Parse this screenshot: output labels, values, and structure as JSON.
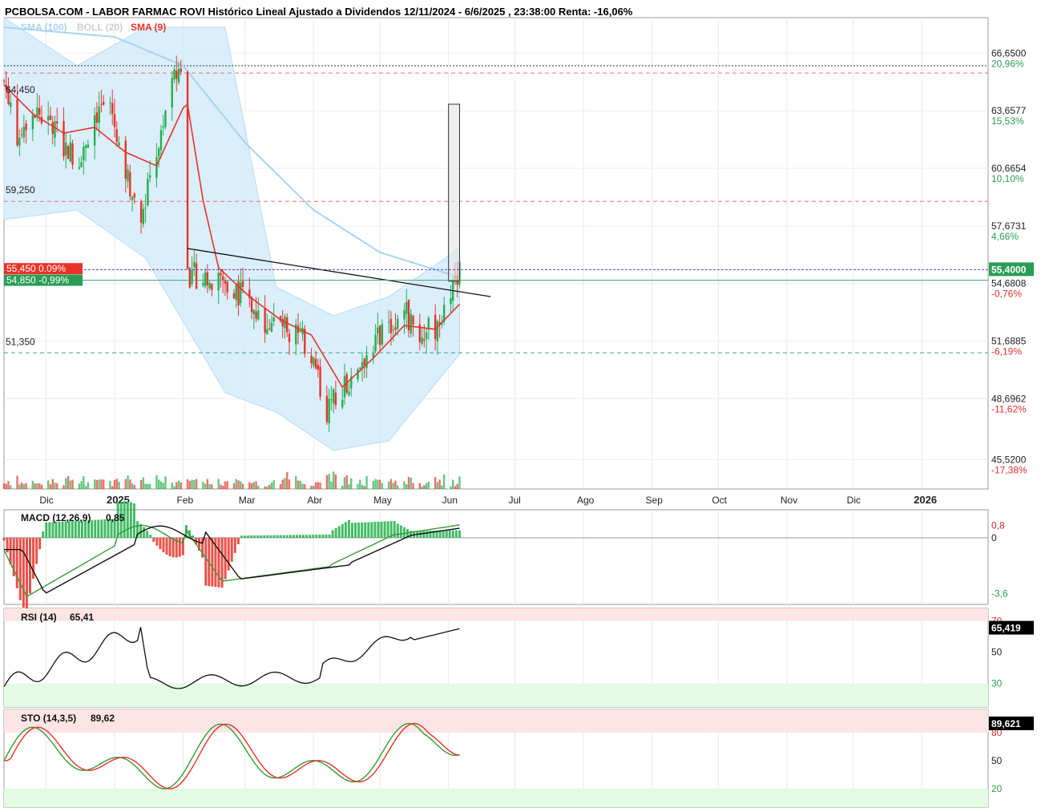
{
  "title": "PCBOLSA.COM - LABOR FARMAC ROVI Histórico Lineal Ajustado a Dividendos 12/11/2024 - 6/6/2025 , 23:38:00 Renta: -16,06%",
  "legend": {
    "sma100": "SMA (100)",
    "boll": "BOLL (20)",
    "sma9": "SMA (9)"
  },
  "colors": {
    "up": "#22b04b",
    "down": "#e8332a",
    "sma9": "#e8332a",
    "sma100": "#a8d4f0",
    "boll_fill": "#cfe8fb",
    "accent_green": "#2a9d55",
    "accent_red": "#e03030"
  },
  "chart_data": [
    {
      "type": "candlestick",
      "name": "price",
      "yrange": [
        44.0,
        68.5
      ],
      "y_axis_levels": [
        {
          "value": 66.65,
          "label": "66,6500",
          "pct": "20,96%",
          "tone": "up"
        },
        {
          "value": 63.6577,
          "label": "63,6577",
          "pct": "15,53%",
          "tone": "up"
        },
        {
          "value": 60.6654,
          "label": "60,6654",
          "pct": "10,10%",
          "tone": "up"
        },
        {
          "value": 57.6731,
          "label": "57,6731",
          "pct": "4,66%",
          "tone": "up"
        },
        {
          "value": 54.6808,
          "label": "54,6808",
          "pct": "-0,76%",
          "tone": "down"
        },
        {
          "value": 51.6885,
          "label": "51,6885",
          "pct": "-6,19%",
          "tone": "down"
        },
        {
          "value": 48.6962,
          "label": "48,6962",
          "pct": "-11,62%",
          "tone": "down"
        },
        {
          "value": 45.52,
          "label": "45,5200",
          "pct": "-17,38%",
          "tone": "down"
        }
      ],
      "left_levels": [
        {
          "value": 64.45,
          "label": "64,450"
        },
        {
          "value": 59.25,
          "label": "59,250"
        },
        {
          "value": 51.35,
          "label": "51,350"
        }
      ],
      "hlines": [
        {
          "value": 65.62,
          "style": "dashed",
          "color": "#f07070"
        },
        {
          "value": 58.95,
          "style": "dashed",
          "color": "#f07070"
        },
        {
          "value": 51.08,
          "style": "dashed",
          "color": "#3aa673"
        },
        {
          "value": 66.0,
          "style": "dotted",
          "color": "#333"
        }
      ],
      "last_price": {
        "value": 55.4,
        "label": "55,4000"
      },
      "markers": [
        {
          "value": 55.45,
          "text": "55,450  0.09%",
          "color": "#e8332a"
        },
        {
          "value": 54.85,
          "text": "54,850  -0,99%",
          "color": "#2a9d55"
        }
      ],
      "x_labels": [
        "Dic",
        "2025",
        "Feb",
        "Mar",
        "Abr",
        "May",
        "Jun",
        "Jul",
        "Ago",
        "Sep",
        "Oct",
        "Nov",
        "Dic",
        "2026"
      ],
      "xrange": [
        "2024-11-12",
        "2026-01-31"
      ],
      "ohlc_anchor_dates": [
        "2024-11-12",
        "2024-12-01",
        "2025-01-01",
        "2025-02-01",
        "2025-03-01",
        "2025-04-01",
        "2025-05-01",
        "2025-06-01",
        "2025-06-06"
      ],
      "close_path": [
        {
          "date": "2024-11-12",
          "value": 65.2
        },
        {
          "date": "2024-11-18",
          "value": 62.5
        },
        {
          "date": "2024-11-25",
          "value": 63.8
        },
        {
          "date": "2024-12-02",
          "value": 63.0
        },
        {
          "date": "2024-12-09",
          "value": 61.8
        },
        {
          "date": "2024-12-16",
          "value": 61.2
        },
        {
          "date": "2024-12-23",
          "value": 63.5
        },
        {
          "date": "2024-12-30",
          "value": 64.0
        },
        {
          "date": "2025-01-06",
          "value": 60.5
        },
        {
          "date": "2025-01-13",
          "value": 58.0
        },
        {
          "date": "2025-01-20",
          "value": 61.5
        },
        {
          "date": "2025-01-27",
          "value": 65.0
        },
        {
          "date": "2025-02-01",
          "value": 66.3
        },
        {
          "date": "2025-02-03",
          "value": 55.2
        },
        {
          "date": "2025-02-10",
          "value": 55.0
        },
        {
          "date": "2025-02-17",
          "value": 54.8
        },
        {
          "date": "2025-02-24",
          "value": 54.5
        },
        {
          "date": "2025-03-03",
          "value": 53.5
        },
        {
          "date": "2025-03-10",
          "value": 52.8
        },
        {
          "date": "2025-03-17",
          "value": 52.5
        },
        {
          "date": "2025-03-24",
          "value": 52.2
        },
        {
          "date": "2025-03-31",
          "value": 51.0
        },
        {
          "date": "2025-04-07",
          "value": 48.0
        },
        {
          "date": "2025-04-14",
          "value": 49.2
        },
        {
          "date": "2025-04-21",
          "value": 50.5
        },
        {
          "date": "2025-04-28",
          "value": 51.5
        },
        {
          "date": "2025-05-05",
          "value": 52.5
        },
        {
          "date": "2025-05-12",
          "value": 53.3
        },
        {
          "date": "2025-05-19",
          "value": 52.0
        },
        {
          "date": "2025-05-26",
          "value": 52.4
        },
        {
          "date": "2025-06-02",
          "value": 54.5
        },
        {
          "date": "2025-06-06",
          "value": 55.4
        }
      ],
      "indicators": {
        "sma9": [
          {
            "date": "2024-11-12",
            "value": 65.0
          },
          {
            "date": "2024-11-25",
            "value": 63.5
          },
          {
            "date": "2024-12-09",
            "value": 62.5
          },
          {
            "date": "2024-12-23",
            "value": 62.8
          },
          {
            "date": "2025-01-06",
            "value": 61.5
          },
          {
            "date": "2025-01-20",
            "value": 60.8
          },
          {
            "date": "2025-02-01",
            "value": 63.8
          },
          {
            "date": "2025-02-03",
            "value": 64.0
          },
          {
            "date": "2025-02-10",
            "value": 59.0
          },
          {
            "date": "2025-02-17",
            "value": 55.5
          },
          {
            "date": "2025-03-03",
            "value": 54.0
          },
          {
            "date": "2025-03-17",
            "value": 52.8
          },
          {
            "date": "2025-03-31",
            "value": 52.0
          },
          {
            "date": "2025-04-14",
            "value": 49.3
          },
          {
            "date": "2025-04-28",
            "value": 50.8
          },
          {
            "date": "2025-05-12",
            "value": 52.5
          },
          {
            "date": "2025-05-26",
            "value": 52.3
          },
          {
            "date": "2025-06-06",
            "value": 53.6
          }
        ],
        "sma100": [
          {
            "date": "2024-11-12",
            "value": 68.0
          },
          {
            "date": "2025-01-01",
            "value": 67.5
          },
          {
            "date": "2025-02-01",
            "value": 66.0
          },
          {
            "date": "2025-03-01",
            "value": 62.0
          },
          {
            "date": "2025-04-01",
            "value": 58.5
          },
          {
            "date": "2025-05-01",
            "value": 56.3
          },
          {
            "date": "2025-06-06",
            "value": 55.0
          }
        ],
        "boll_upper": [
          {
            "date": "2024-11-12",
            "value": 68.5
          },
          {
            "date": "2024-12-15",
            "value": 66.0
          },
          {
            "date": "2025-01-15",
            "value": 68.0
          },
          {
            "date": "2025-02-20",
            "value": 68.0
          },
          {
            "date": "2025-03-15",
            "value": 54.5
          },
          {
            "date": "2025-04-10",
            "value": 53.0
          },
          {
            "date": "2025-05-05",
            "value": 54.0
          },
          {
            "date": "2025-06-06",
            "value": 56.5
          }
        ],
        "boll_lower": [
          {
            "date": "2024-11-12",
            "value": 58.0
          },
          {
            "date": "2024-12-15",
            "value": 58.5
          },
          {
            "date": "2025-01-15",
            "value": 56.0
          },
          {
            "date": "2025-02-20",
            "value": 49.0
          },
          {
            "date": "2025-03-15",
            "value": 48.0
          },
          {
            "date": "2025-04-10",
            "value": 46.0
          },
          {
            "date": "2025-05-05",
            "value": 46.5
          },
          {
            "date": "2025-06-06",
            "value": 51.0
          }
        ]
      },
      "trendline": [
        {
          "date": "2025-02-03",
          "value": 56.5
        },
        {
          "date": "2025-06-20",
          "value": 54.0
        }
      ],
      "box": {
        "from": "2025-06-01",
        "to": "2025-06-06",
        "low": 54.8,
        "high": 64.0
      }
    },
    {
      "type": "line",
      "name": "macd",
      "label": "MACD (12,26,9)",
      "value_label": "0,85",
      "y_labels": [
        {
          "value": 0.8,
          "label": "0,8"
        },
        {
          "value": 0,
          "label": "0"
        },
        {
          "value": -3.6,
          "label": "-3,6"
        }
      ]
    },
    {
      "type": "line",
      "name": "rsi",
      "label": "RSI (14)",
      "value_label": "65,41",
      "current": "65,419",
      "y_labels": [
        {
          "value": 70,
          "label": "70"
        },
        {
          "value": 50,
          "label": "50"
        },
        {
          "value": 30,
          "label": "30"
        }
      ]
    },
    {
      "type": "line",
      "name": "sto",
      "label": "STO (14,3,5)",
      "value_label": "89,62",
      "current": "89,621",
      "y_labels": [
        {
          "value": 80,
          "label": "80"
        },
        {
          "value": 50,
          "label": "50"
        },
        {
          "value": 20,
          "label": "20"
        }
      ]
    }
  ]
}
